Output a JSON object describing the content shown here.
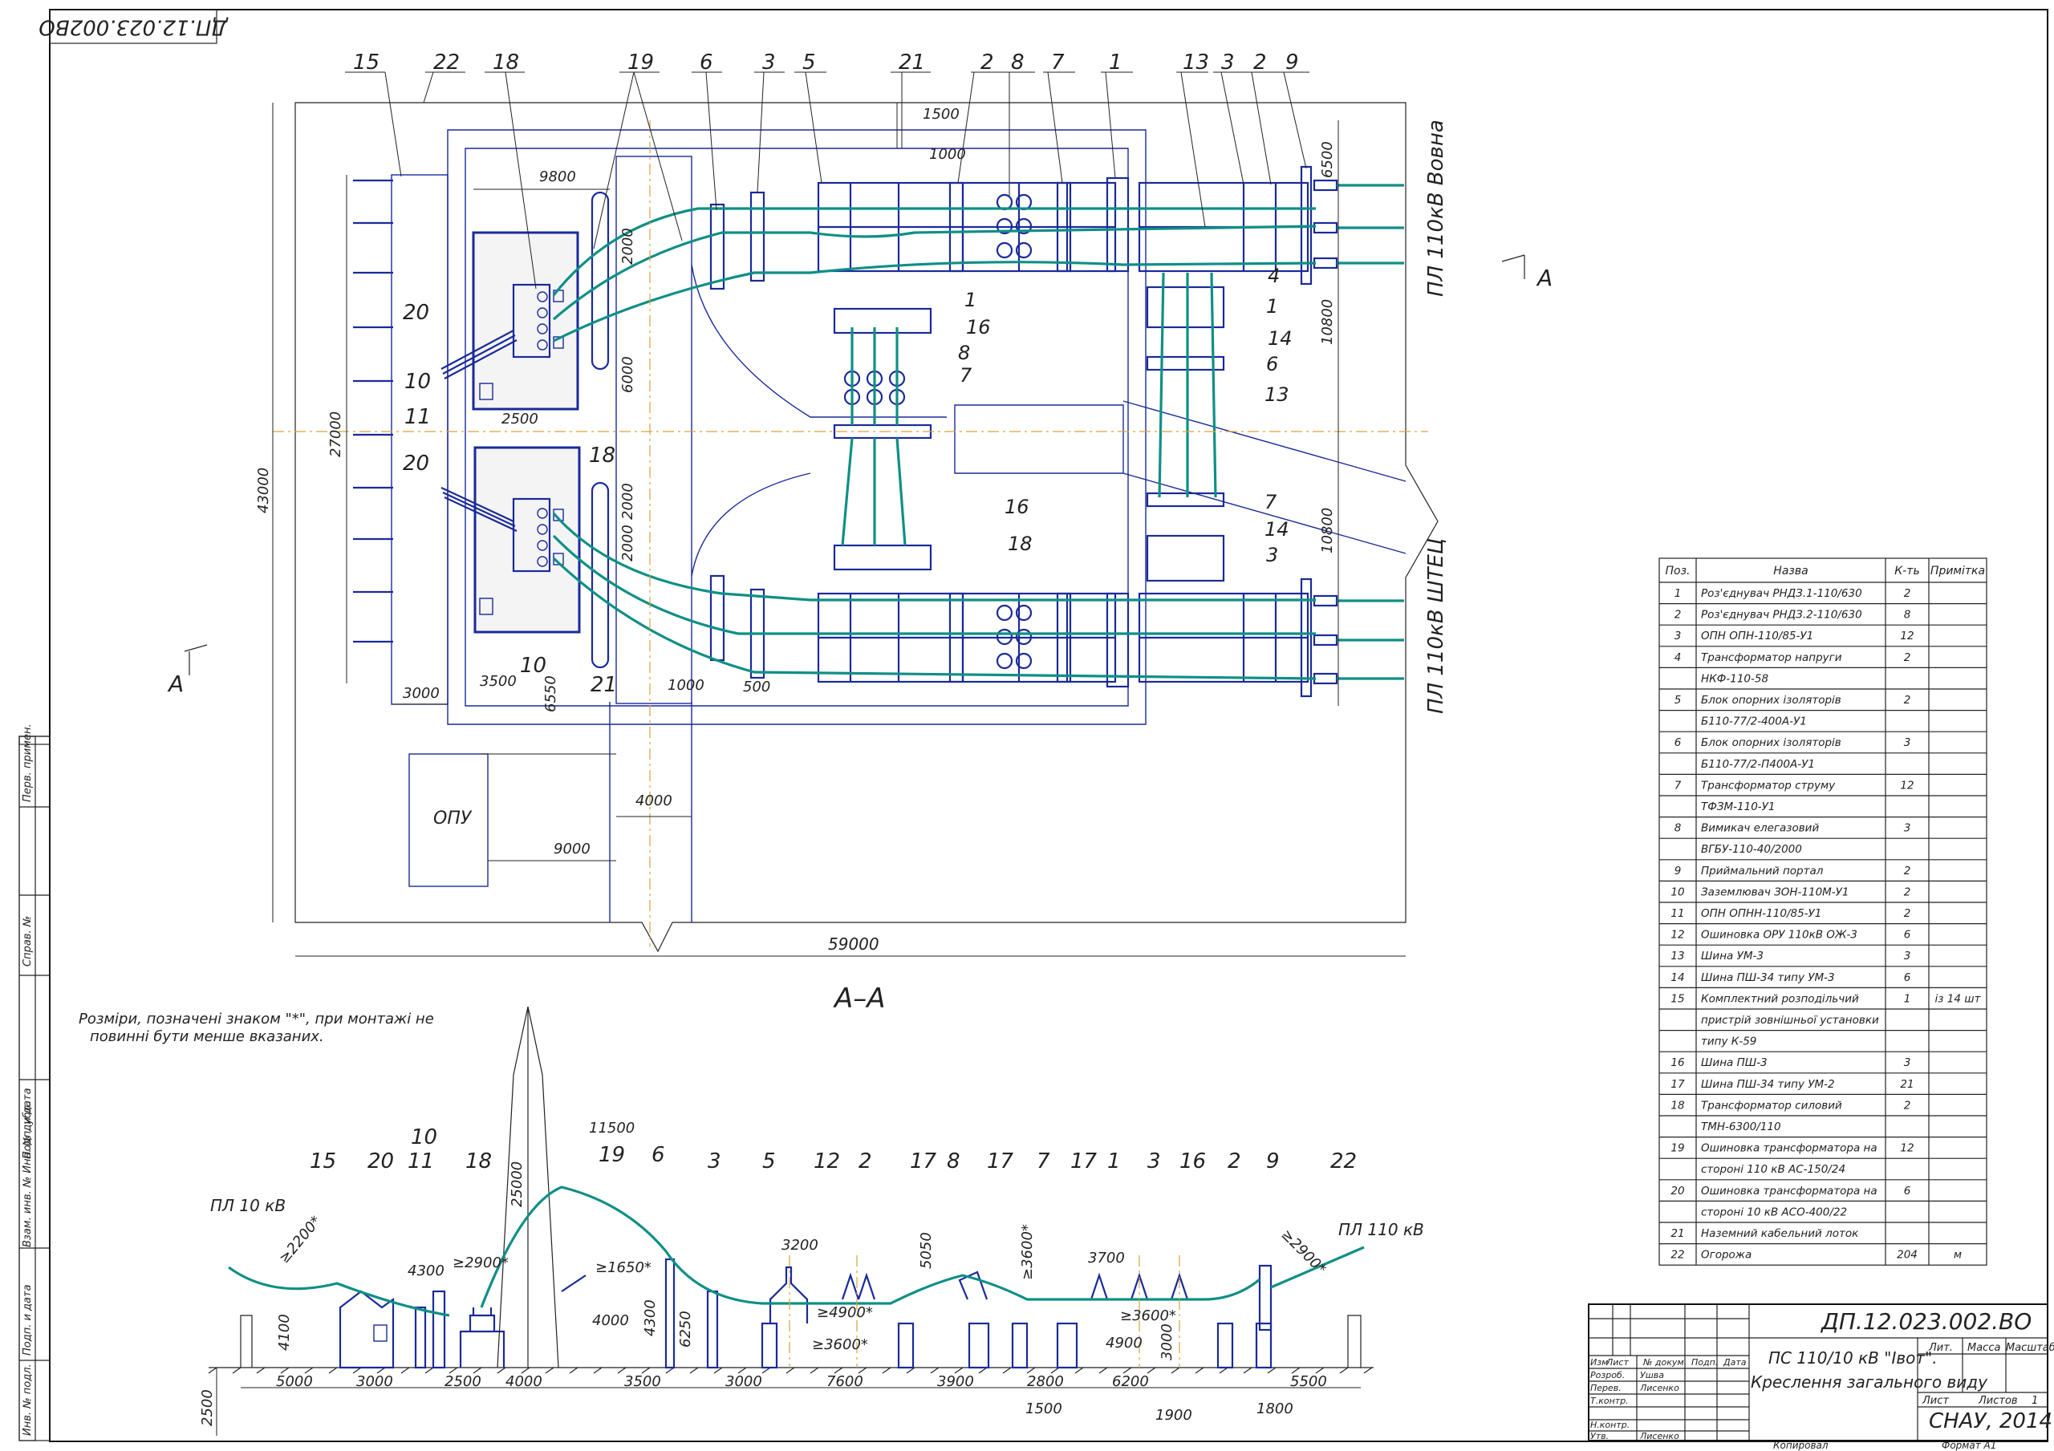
{
  "drawing": {
    "code": "ДП.12.023.002.ВО",
    "code_rotated": "ДП.12.023.002ВО",
    "section_title": "А–А",
    "section_marker": "А",
    "note": [
      "Розміри, позначені знаком \"*\", при монтажі не",
      "повинні бути менше вказаних."
    ]
  },
  "plan": {
    "callouts_top": [
      "15",
      "22",
      "18",
      "19",
      "6",
      "3",
      "5",
      "21",
      "2",
      "8",
      "7",
      "1",
      "13",
      "3",
      "2",
      "9"
    ],
    "callouts_mid": [
      "1",
      "16",
      "8",
      "7",
      "4",
      "1",
      "14",
      "6",
      "13",
      "7",
      "14",
      "18",
      "16",
      "3"
    ],
    "callouts_left": [
      "20",
      "10",
      "11",
      "20",
      "18",
      "10",
      "21"
    ],
    "dims": [
      "9800",
      "1500",
      "1000",
      "2000",
      "6000",
      "2000",
      "2000",
      "2500",
      "27000",
      "43000",
      "3000",
      "3500",
      "6550",
      "1000",
      "500",
      "4000",
      "9000",
      "59000",
      "6500",
      "10800",
      "10800"
    ],
    "opu_label": "ОПУ",
    "line_top": "ПЛ 110кВ Вовна",
    "line_bottom": "ПЛ 110кВ ШТЕЦ"
  },
  "section": {
    "callouts": [
      "15",
      "20",
      "11",
      "10",
      "18",
      "19",
      "6",
      "3",
      "5",
      "12",
      "2",
      "17",
      "8",
      "17",
      "7",
      "17",
      "1",
      "3",
      "16",
      "2",
      "9",
      "22"
    ],
    "left_line": "ПЛ 10 кВ",
    "right_line": "ПЛ 110 кВ",
    "dims_bottom": [
      "5000",
      "3000",
      "2500",
      "4000",
      "3500",
      "3000",
      "7600",
      "3900",
      "2800",
      "6200",
      "5500",
      "1500",
      "1900",
      "1800"
    ],
    "dims_other": [
      "2500",
      "4100",
      "4300",
      "≥2200*",
      "≥2900*",
      "11500",
      "25000",
      "≥1650*",
      "4000",
      "4300",
      "6250",
      "3200",
      "≥4900*",
      "≥3600*",
      "5050",
      "≥3600*",
      "3700",
      "≥3600*",
      "4900",
      "3000",
      "≥2900*"
    ]
  },
  "table": {
    "headers": [
      "Поз.",
      "Назва",
      "К-ть",
      "Примітка"
    ],
    "rows": [
      [
        "1",
        "Роз'єднувач РНДЗ.1-110/630",
        "2",
        ""
      ],
      [
        "2",
        "Роз'єднувач РНДЗ.2-110/630",
        "8",
        ""
      ],
      [
        "3",
        "ОПН ОПН-110/85-У1",
        "12",
        ""
      ],
      [
        "4",
        "Трансформатор напруги",
        "2",
        ""
      ],
      [
        "",
        "НКФ-110-58",
        "",
        ""
      ],
      [
        "5",
        "Блок опорних ізоляторів",
        "2",
        ""
      ],
      [
        "",
        "Б110-77/2-400А-У1",
        "",
        ""
      ],
      [
        "6",
        "Блок опорних ізоляторів",
        "3",
        ""
      ],
      [
        "",
        "Б110-77/2-П400А-У1",
        "",
        ""
      ],
      [
        "7",
        "Трансформатор струму",
        "12",
        ""
      ],
      [
        "",
        "ТФЗМ-110-У1",
        "",
        ""
      ],
      [
        "8",
        "Вимикач елегазовий",
        "3",
        ""
      ],
      [
        "",
        "ВГБУ-110-40/2000",
        "",
        ""
      ],
      [
        "9",
        "Приймальний портал",
        "2",
        ""
      ],
      [
        "10",
        "Заземлювач ЗОН-110М-У1",
        "2",
        ""
      ],
      [
        "11",
        "ОПН ОПНН-110/85-У1",
        "2",
        ""
      ],
      [
        "12",
        "Ошиновка ОРУ 110кВ ОЖ-3",
        "6",
        ""
      ],
      [
        "13",
        "Шина УМ-3",
        "3",
        ""
      ],
      [
        "14",
        "Шина ПШ-34 типу УМ-3",
        "6",
        ""
      ],
      [
        "15",
        "Комплектний розподільчий",
        "1",
        "із 14 шт"
      ],
      [
        "",
        "пристрій зовнішньої установки",
        "",
        ""
      ],
      [
        "",
        "типу К-59",
        "",
        ""
      ],
      [
        "16",
        "Шина ПШ-3",
        "3",
        ""
      ],
      [
        "17",
        "Шина ПШ-34 типу УМ-2",
        "21",
        ""
      ],
      [
        "18",
        "Трансформатор силовий",
        "2",
        ""
      ],
      [
        "",
        "ТМН-6300/110",
        "",
        ""
      ],
      [
        "19",
        "Ошиновка трансформатора на",
        "12",
        ""
      ],
      [
        "",
        "стороні 110 кВ АС-150/24",
        "",
        ""
      ],
      [
        "20",
        "Ошиновка трансформатора на",
        "6",
        ""
      ],
      [
        "",
        "стороні 10 кВ АСО-400/22",
        "",
        ""
      ],
      [
        "21",
        "Наземний кабельний лоток",
        "",
        ""
      ],
      [
        "22",
        "Огорожа",
        "204",
        "м"
      ]
    ]
  },
  "stamp": {
    "code": "ДП.12.023.002.ВО",
    "title_line1": "ПС 110/10 кВ \"Івот\".",
    "title_line2": "Креслення загального виду",
    "col_labels": [
      "Изм",
      "Лист",
      "№ докум.",
      "Подп.",
      "Дата"
    ],
    "roles": [
      "Розроб.",
      "Перев.",
      "Т.контр.",
      "",
      "Н.контр.",
      "Утв."
    ],
    "names": [
      "Ушва",
      "Лисенко",
      "",
      "",
      "",
      "Лисенко"
    ],
    "lit_label": "Лит.",
    "mass_label": "Масса",
    "scale_label": "Масштаб",
    "sheet_label": "Лист",
    "sheets_label": "Листов",
    "sheets_value": "1",
    "org": "СНАУ, 2014",
    "copied": "Копировал",
    "format": "Формат   А1"
  },
  "side_stamp": [
    "Перв. примен.",
    "Справ. №",
    "Подп. и дата",
    "Взам. инв. № Инв. № дубл.",
    "Подп. и дата",
    "Инв. № подл."
  ]
}
